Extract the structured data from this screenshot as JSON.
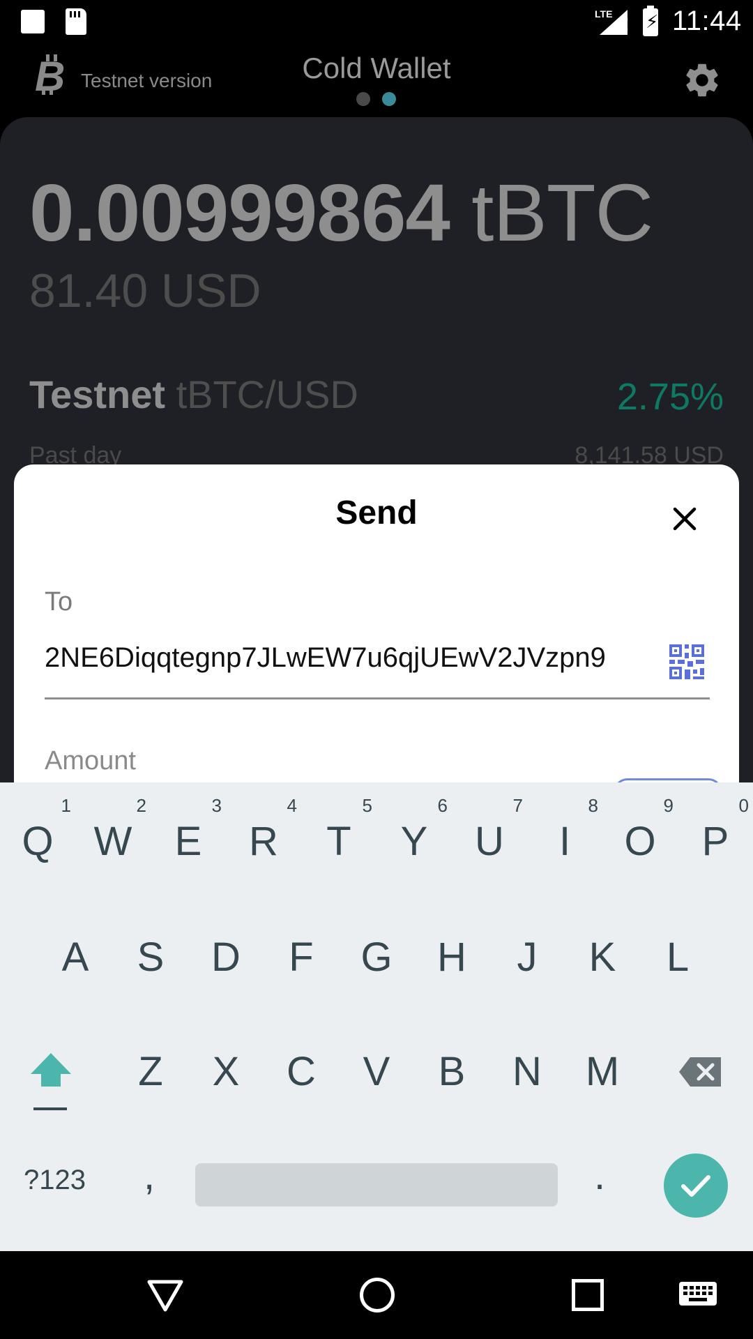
{
  "status_bar": {
    "time": "11:44",
    "network": "LTE",
    "icons": [
      "notification-square-icon",
      "sd-card-icon",
      "signal-icon",
      "battery-charging-icon"
    ]
  },
  "header": {
    "logo_icon": "bitcoin-icon",
    "testnet_label": "Testnet version",
    "title": "Cold Wallet",
    "settings_icon": "gear-icon",
    "page_count": 2,
    "active_page": 2
  },
  "balance": {
    "amount": "0.00999864",
    "unit": "tBTC",
    "fiat": "81.40 USD"
  },
  "market": {
    "network": "Testnet",
    "pair": "tBTC/USD",
    "change": "2.75%",
    "period": "Past day",
    "price": "8,141.58 USD"
  },
  "send_sheet": {
    "title": "Send",
    "close_icon": "close-icon",
    "to_label": "To",
    "to_value": "2NE6Diqqtegnp7JLwEW7u6qjUEwV2JVzpn9",
    "scan_icon": "qr-code-icon",
    "amount_label": "Amount"
  },
  "keyboard": {
    "row1": [
      {
        "key": "Q",
        "hint": "1"
      },
      {
        "key": "W",
        "hint": "2"
      },
      {
        "key": "E",
        "hint": "3"
      },
      {
        "key": "R",
        "hint": "4"
      },
      {
        "key": "T",
        "hint": "5"
      },
      {
        "key": "Y",
        "hint": "6"
      },
      {
        "key": "U",
        "hint": "7"
      },
      {
        "key": "I",
        "hint": "8"
      },
      {
        "key": "O",
        "hint": "9"
      },
      {
        "key": "P",
        "hint": "0"
      }
    ],
    "row2": [
      "A",
      "S",
      "D",
      "F",
      "G",
      "H",
      "J",
      "K",
      "L"
    ],
    "row3": [
      "Z",
      "X",
      "C",
      "V",
      "B",
      "N",
      "M"
    ],
    "symbols_label": "?123",
    "comma": ",",
    "period": ".",
    "shift_icon": "shift-icon",
    "backspace_icon": "backspace-icon",
    "enter_icon": "checkmark-icon"
  },
  "nav_bar": {
    "icons": [
      "back-triangle-icon",
      "home-circle-icon",
      "recents-square-icon",
      "keyboard-icon"
    ]
  },
  "colors": {
    "accent_teal": "#3b8a99",
    "positive_green": "#0f7a64",
    "keyboard_bg": "#eceff1",
    "enter_key": "#4db6ac",
    "qr_blue": "#5b6fd6"
  }
}
